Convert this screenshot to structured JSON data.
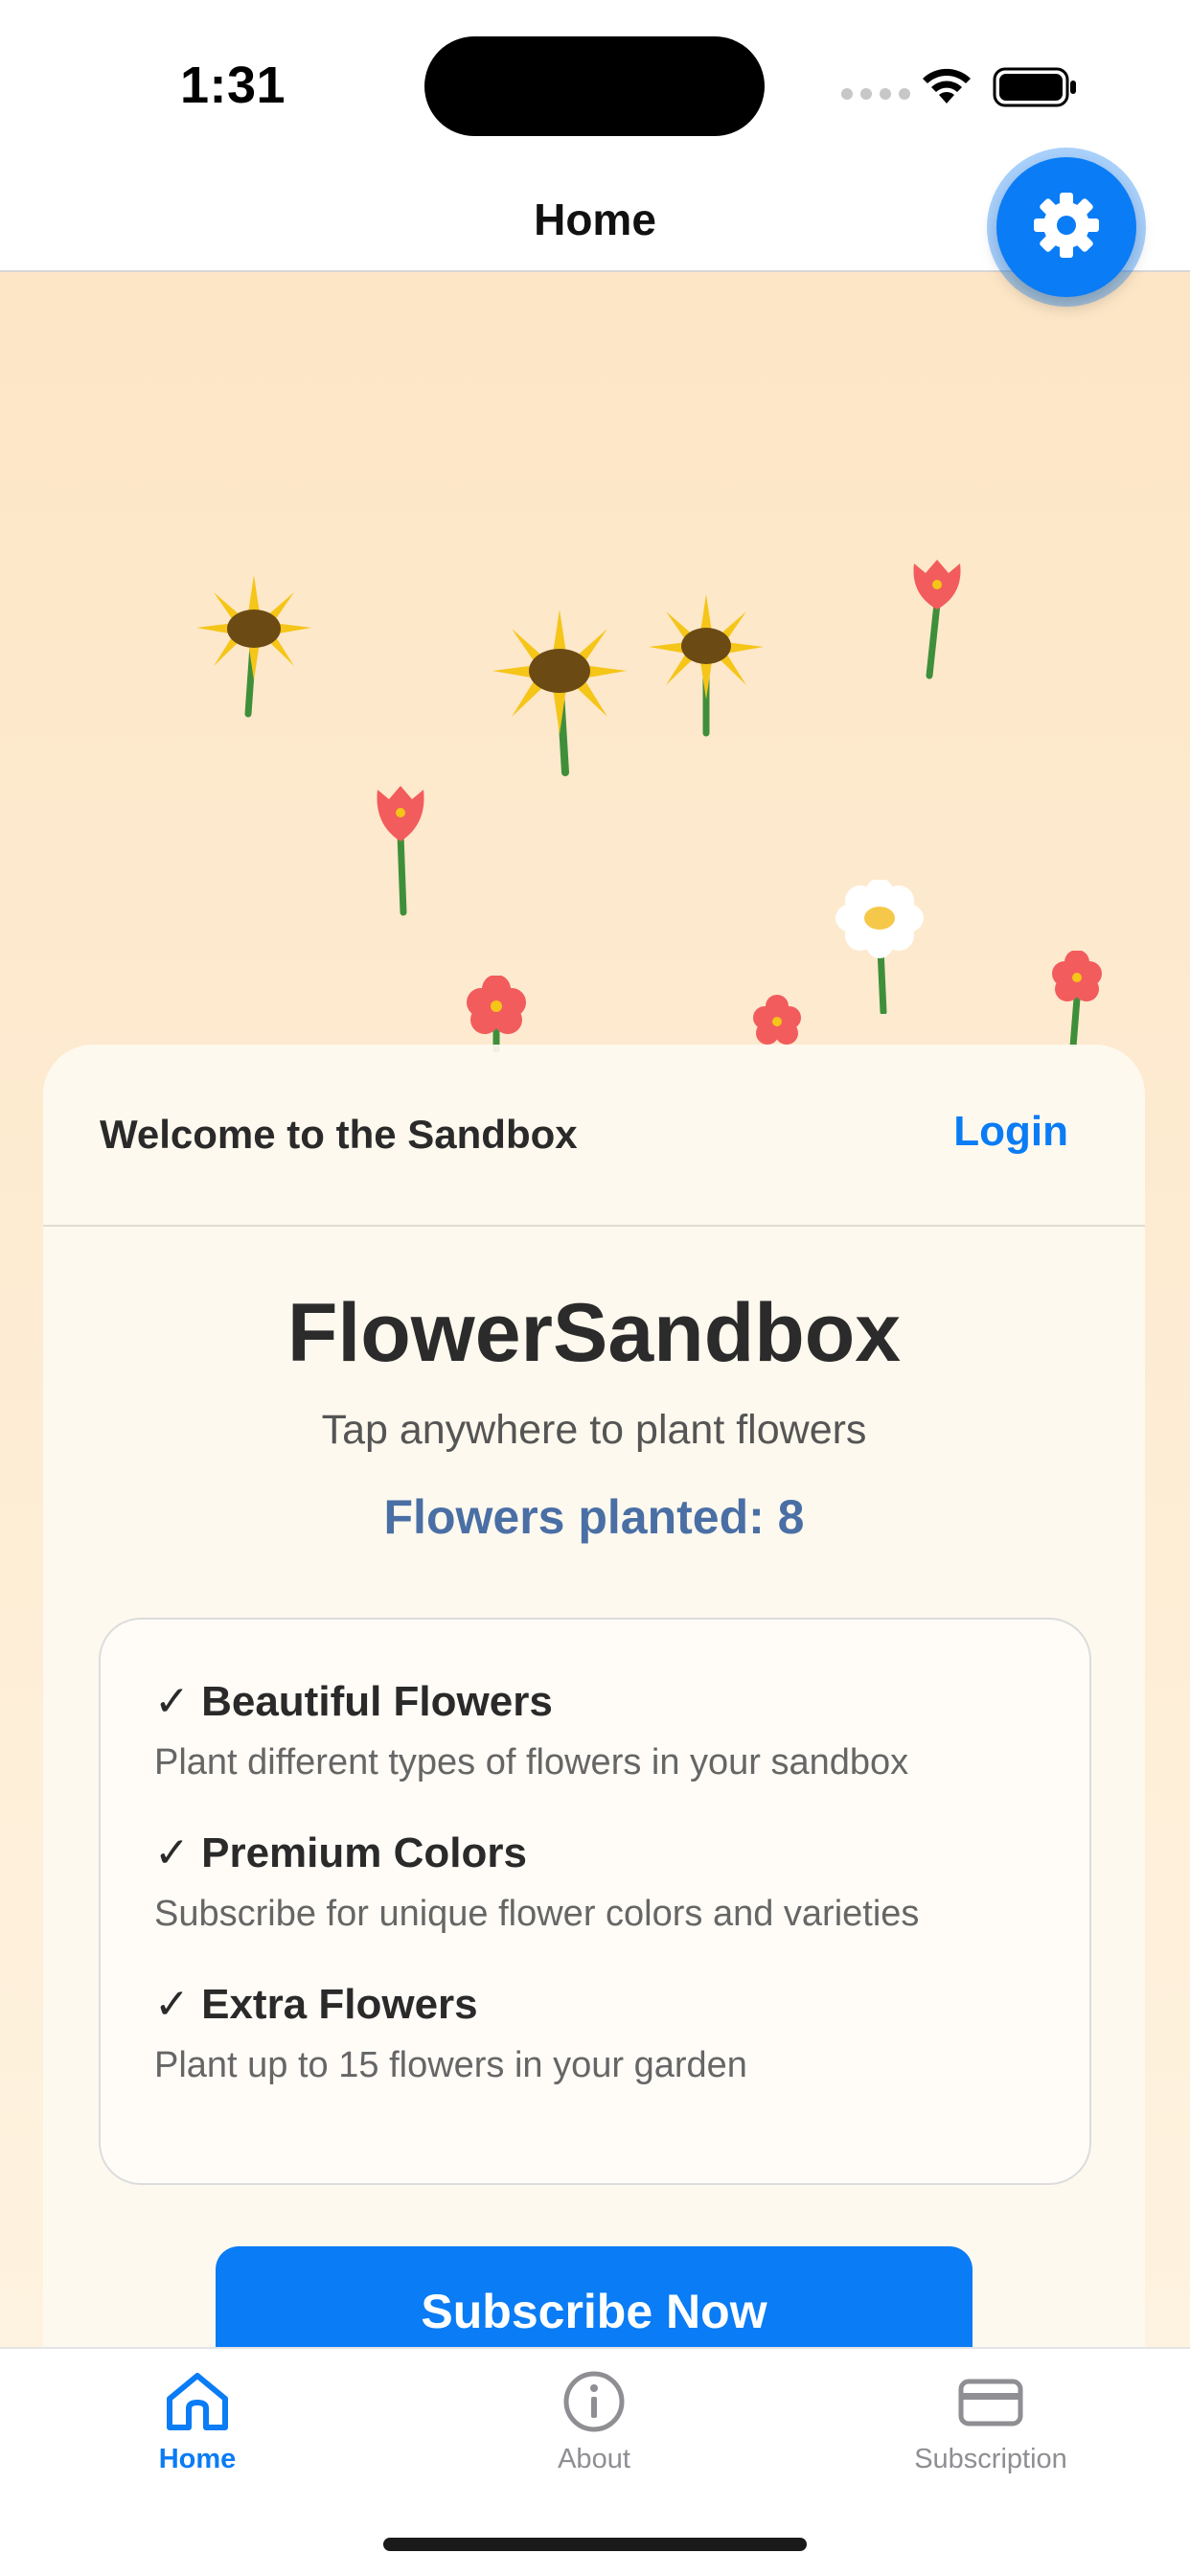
{
  "status_bar": {
    "time": "1:31"
  },
  "nav": {
    "title": "Home",
    "settings_icon": "gear-icon"
  },
  "colors": {
    "accent": "#0a7cf5",
    "garden_background": "#fde6c6",
    "planted_count": "#4a6fa5",
    "tab_inactive": "#8e8e93"
  },
  "garden": {
    "flowers": [
      {
        "type": "sunflower"
      },
      {
        "type": "sunflower"
      },
      {
        "type": "sunflower"
      },
      {
        "type": "tulip"
      },
      {
        "type": "tulip"
      },
      {
        "type": "daisy"
      },
      {
        "type": "rose"
      },
      {
        "type": "rose"
      },
      {
        "type": "rose"
      }
    ]
  },
  "card": {
    "welcome": "Welcome to the Sandbox",
    "login": "Login",
    "title": "FlowerSandbox",
    "subtitle": "Tap anywhere to plant flowers",
    "planted": "Flowers planted: 8",
    "features": [
      {
        "title": "✓ Beautiful Flowers",
        "desc": "Plant different types of flowers in your sandbox"
      },
      {
        "title": "✓ Premium Colors",
        "desc": "Subscribe for unique flower colors and varieties"
      },
      {
        "title": "✓ Extra Flowers",
        "desc": "Plant up to 15 flowers in your garden"
      }
    ],
    "subscribe": "Subscribe Now"
  },
  "tab_bar": {
    "tabs": [
      {
        "label": "Home",
        "icon": "home-icon",
        "selected": true
      },
      {
        "label": "About",
        "icon": "info-icon",
        "selected": false
      },
      {
        "label": "Subscription",
        "icon": "credit-card-icon",
        "selected": false
      }
    ]
  }
}
